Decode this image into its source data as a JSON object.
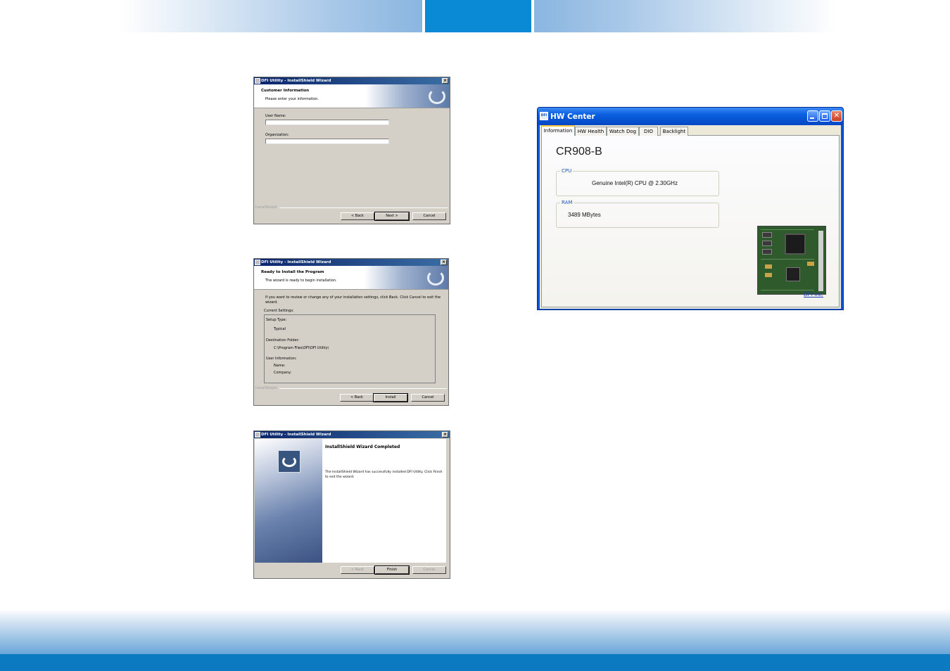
{
  "dialog1": {
    "window_title": "DFI Utility - InstallShield Wizard",
    "header_title": "Customer Information",
    "header_subtitle": "Please enter your information.",
    "user_name_label": "User Name:",
    "user_name_value": "",
    "organization_label": "Organization:",
    "organization_value": "",
    "brand": "InstallShield",
    "back_label": "< Back",
    "next_label": "Next >",
    "cancel_label": "Cancel"
  },
  "dialog2": {
    "window_title": "DFI Utility - InstallShield Wizard",
    "header_title": "Ready to Install the Program",
    "header_subtitle": "The wizard is ready to begin installation.",
    "intro": "If you want to review or change any of your installation settings, click Back. Click Cancel to exit the wizard.",
    "current_settings_label": "Current Settings:",
    "setup_type_label": "Setup Type:",
    "setup_type_value": "Typical",
    "destination_label": "Destination Folder:",
    "destination_value": "C:\\Program Files\\DFI\\DFI Utility\\",
    "user_info_label": "User Information:",
    "name_label": "Name:",
    "company_label": "Company:",
    "brand": "InstallShield",
    "back_label": "< Back",
    "install_label": "Install",
    "cancel_label": "Cancel"
  },
  "dialog3": {
    "window_title": "DFI Utility - InstallShield Wizard",
    "title": "InstallShield Wizard Completed",
    "message": "The InstallShield Wizard has successfully installed DFI Utility. Click Finish to exit the wizard.",
    "back_label": "< Back",
    "finish_label": "Finish",
    "cancel_label": "Cancel"
  },
  "hw_center": {
    "app_icon_text": "DFI",
    "window_title": "HW Center",
    "tabs": [
      "Information",
      "HW Health",
      "Watch Dog",
      "DIO",
      "Backlight"
    ],
    "active_tab": "Information",
    "model": "CR908-B",
    "cpu_label": "CPU",
    "cpu_value": "Genuine Intel(R) CPU  @ 2.30GHz",
    "ram_label": "RAM",
    "ram_value": "3489 MBytes",
    "link_text": "DFI Inc."
  },
  "colors": {
    "accent_blue": "#0a8ad4",
    "bottom_bar": "#0b7ac0",
    "xp_titlebar": "#0a5fe0",
    "dialog_face": "#d4d0c8"
  }
}
